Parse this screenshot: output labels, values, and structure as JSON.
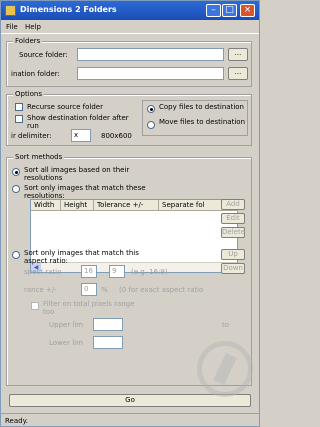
{
  "window": {
    "title": "Dimensions 2 Folders"
  },
  "menu": {
    "file": "File",
    "help": "Help"
  },
  "folders": {
    "legend": "Folders",
    "source_label": "Source folder:",
    "dest_label": "ination folder:",
    "browse": "..."
  },
  "options": {
    "legend": "Options",
    "recurse": "Recurse source folder",
    "show_dest": "Show destination folder after run",
    "delimiter_label": "ir delimiter:",
    "delimiter_value": "x",
    "example": "800x600",
    "copy": "Copy files to destination",
    "move": "Move files to destination"
  },
  "sort": {
    "legend": "Sort methods",
    "opt_all": "Sort all images based on their resolutions",
    "opt_match_res": "Sort only images that match these resolutions:",
    "columns": [
      "Width",
      "Height",
      "Tolerance +/-",
      "Separate fol"
    ],
    "buttons": {
      "add": "Add",
      "edit": "Edit",
      "delete": "Delete",
      "up": "Up",
      "down": "Down"
    },
    "opt_aspect": "Sort only images that match this aspect ratio:",
    "aspect_label": "spect ratio",
    "aspect_w": "16",
    "aspect_h": "9",
    "aspect_example": "(e.g. 16:9)",
    "tolerance_label": "rance +/-",
    "tolerance_value": "0",
    "tolerance_unit": "%",
    "tolerance_hint": "(0 for exact aspect ratio",
    "filter": "Filter on total pixels range",
    "filter_too": "too",
    "upper": "Upper lim",
    "to": "to",
    "lower": "Lower lim"
  },
  "go": "Go",
  "status": "Ready."
}
